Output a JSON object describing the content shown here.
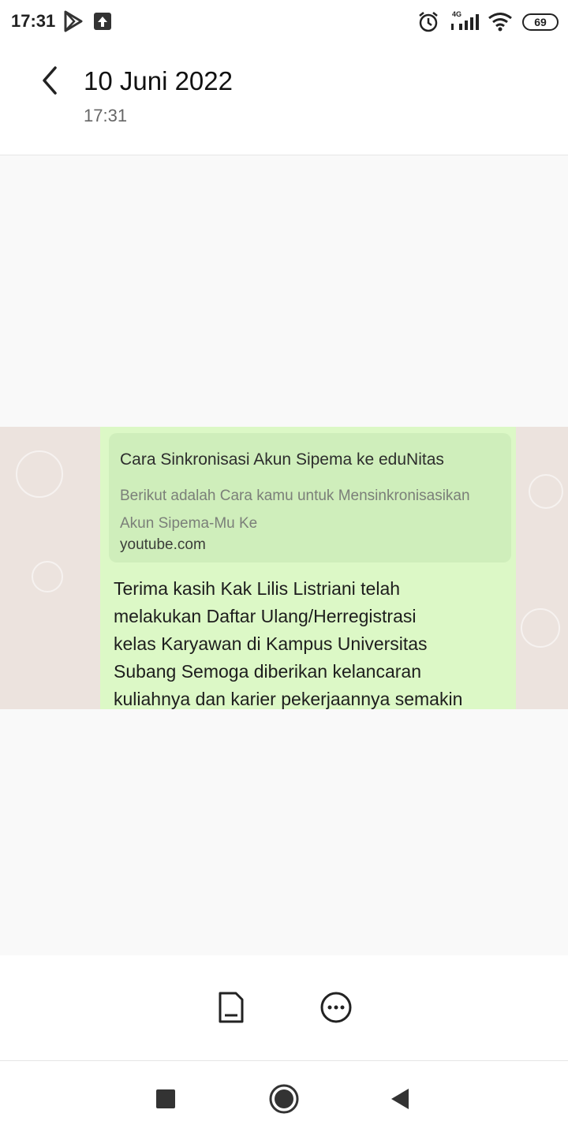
{
  "status_bar": {
    "time": "17:31",
    "network": "4G",
    "battery": "69"
  },
  "header": {
    "title": "10 Juni 2022",
    "subtitle": "17:31"
  },
  "photo": {
    "link_preview": {
      "title": "Cara Sinkronisasi Akun Sipema ke eduNitas",
      "description": "Berikut adalah Cara kamu untuk Mensinkronisasikan Akun Sipema-Mu Ke",
      "domain": "youtube.com"
    },
    "message": "Terima kasih Kak Lilis Listriani telah\nmelakukan Daftar Ulang/Herregistrasi\nkelas Karyawan di Kampus Universitas\nSubang Semoga diberikan kelancaran\nkuliahnya dan karier pekerjaannya semakin"
  },
  "colors": {
    "bubble": "#dcf8c6",
    "chat_background": "#ece3de",
    "viewer_background": "#f9f9f9"
  },
  "icons": {
    "status_left": [
      "play-store-icon",
      "upload-icon"
    ],
    "status_right": [
      "alarm-icon",
      "signal-icon",
      "wifi-icon",
      "battery-icon"
    ],
    "toolbar": [
      "set-as-icon",
      "more-options-icon"
    ],
    "navigation": [
      "recents-icon",
      "home-icon",
      "back-nav-icon"
    ]
  }
}
